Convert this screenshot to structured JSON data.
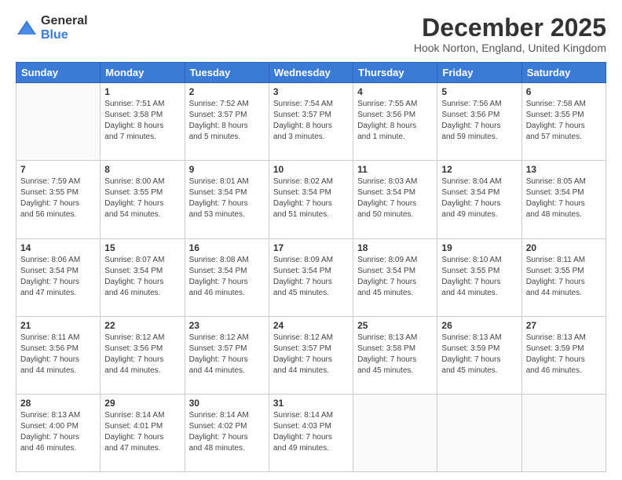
{
  "logo": {
    "general": "General",
    "blue": "Blue"
  },
  "title": "December 2025",
  "location": "Hook Norton, England, United Kingdom",
  "weekdays": [
    "Sunday",
    "Monday",
    "Tuesday",
    "Wednesday",
    "Thursday",
    "Friday",
    "Saturday"
  ],
  "weeks": [
    [
      {
        "day": "",
        "info": ""
      },
      {
        "day": "1",
        "info": "Sunrise: 7:51 AM\nSunset: 3:58 PM\nDaylight: 8 hours\nand 7 minutes."
      },
      {
        "day": "2",
        "info": "Sunrise: 7:52 AM\nSunset: 3:57 PM\nDaylight: 8 hours\nand 5 minutes."
      },
      {
        "day": "3",
        "info": "Sunrise: 7:54 AM\nSunset: 3:57 PM\nDaylight: 8 hours\nand 3 minutes."
      },
      {
        "day": "4",
        "info": "Sunrise: 7:55 AM\nSunset: 3:56 PM\nDaylight: 8 hours\nand 1 minute."
      },
      {
        "day": "5",
        "info": "Sunrise: 7:56 AM\nSunset: 3:56 PM\nDaylight: 7 hours\nand 59 minutes."
      },
      {
        "day": "6",
        "info": "Sunrise: 7:58 AM\nSunset: 3:55 PM\nDaylight: 7 hours\nand 57 minutes."
      }
    ],
    [
      {
        "day": "7",
        "info": "Sunrise: 7:59 AM\nSunset: 3:55 PM\nDaylight: 7 hours\nand 56 minutes."
      },
      {
        "day": "8",
        "info": "Sunrise: 8:00 AM\nSunset: 3:55 PM\nDaylight: 7 hours\nand 54 minutes."
      },
      {
        "day": "9",
        "info": "Sunrise: 8:01 AM\nSunset: 3:54 PM\nDaylight: 7 hours\nand 53 minutes."
      },
      {
        "day": "10",
        "info": "Sunrise: 8:02 AM\nSunset: 3:54 PM\nDaylight: 7 hours\nand 51 minutes."
      },
      {
        "day": "11",
        "info": "Sunrise: 8:03 AM\nSunset: 3:54 PM\nDaylight: 7 hours\nand 50 minutes."
      },
      {
        "day": "12",
        "info": "Sunrise: 8:04 AM\nSunset: 3:54 PM\nDaylight: 7 hours\nand 49 minutes."
      },
      {
        "day": "13",
        "info": "Sunrise: 8:05 AM\nSunset: 3:54 PM\nDaylight: 7 hours\nand 48 minutes."
      }
    ],
    [
      {
        "day": "14",
        "info": "Sunrise: 8:06 AM\nSunset: 3:54 PM\nDaylight: 7 hours\nand 47 minutes."
      },
      {
        "day": "15",
        "info": "Sunrise: 8:07 AM\nSunset: 3:54 PM\nDaylight: 7 hours\nand 46 minutes."
      },
      {
        "day": "16",
        "info": "Sunrise: 8:08 AM\nSunset: 3:54 PM\nDaylight: 7 hours\nand 46 minutes."
      },
      {
        "day": "17",
        "info": "Sunrise: 8:09 AM\nSunset: 3:54 PM\nDaylight: 7 hours\nand 45 minutes."
      },
      {
        "day": "18",
        "info": "Sunrise: 8:09 AM\nSunset: 3:54 PM\nDaylight: 7 hours\nand 45 minutes."
      },
      {
        "day": "19",
        "info": "Sunrise: 8:10 AM\nSunset: 3:55 PM\nDaylight: 7 hours\nand 44 minutes."
      },
      {
        "day": "20",
        "info": "Sunrise: 8:11 AM\nSunset: 3:55 PM\nDaylight: 7 hours\nand 44 minutes."
      }
    ],
    [
      {
        "day": "21",
        "info": "Sunrise: 8:11 AM\nSunset: 3:56 PM\nDaylight: 7 hours\nand 44 minutes."
      },
      {
        "day": "22",
        "info": "Sunrise: 8:12 AM\nSunset: 3:56 PM\nDaylight: 7 hours\nand 44 minutes."
      },
      {
        "day": "23",
        "info": "Sunrise: 8:12 AM\nSunset: 3:57 PM\nDaylight: 7 hours\nand 44 minutes."
      },
      {
        "day": "24",
        "info": "Sunrise: 8:12 AM\nSunset: 3:57 PM\nDaylight: 7 hours\nand 44 minutes."
      },
      {
        "day": "25",
        "info": "Sunrise: 8:13 AM\nSunset: 3:58 PM\nDaylight: 7 hours\nand 45 minutes."
      },
      {
        "day": "26",
        "info": "Sunrise: 8:13 AM\nSunset: 3:59 PM\nDaylight: 7 hours\nand 45 minutes."
      },
      {
        "day": "27",
        "info": "Sunrise: 8:13 AM\nSunset: 3:59 PM\nDaylight: 7 hours\nand 46 minutes."
      }
    ],
    [
      {
        "day": "28",
        "info": "Sunrise: 8:13 AM\nSunset: 4:00 PM\nDaylight: 7 hours\nand 46 minutes."
      },
      {
        "day": "29",
        "info": "Sunrise: 8:14 AM\nSunset: 4:01 PM\nDaylight: 7 hours\nand 47 minutes."
      },
      {
        "day": "30",
        "info": "Sunrise: 8:14 AM\nSunset: 4:02 PM\nDaylight: 7 hours\nand 48 minutes."
      },
      {
        "day": "31",
        "info": "Sunrise: 8:14 AM\nSunset: 4:03 PM\nDaylight: 7 hours\nand 49 minutes."
      },
      {
        "day": "",
        "info": ""
      },
      {
        "day": "",
        "info": ""
      },
      {
        "day": "",
        "info": ""
      }
    ]
  ]
}
